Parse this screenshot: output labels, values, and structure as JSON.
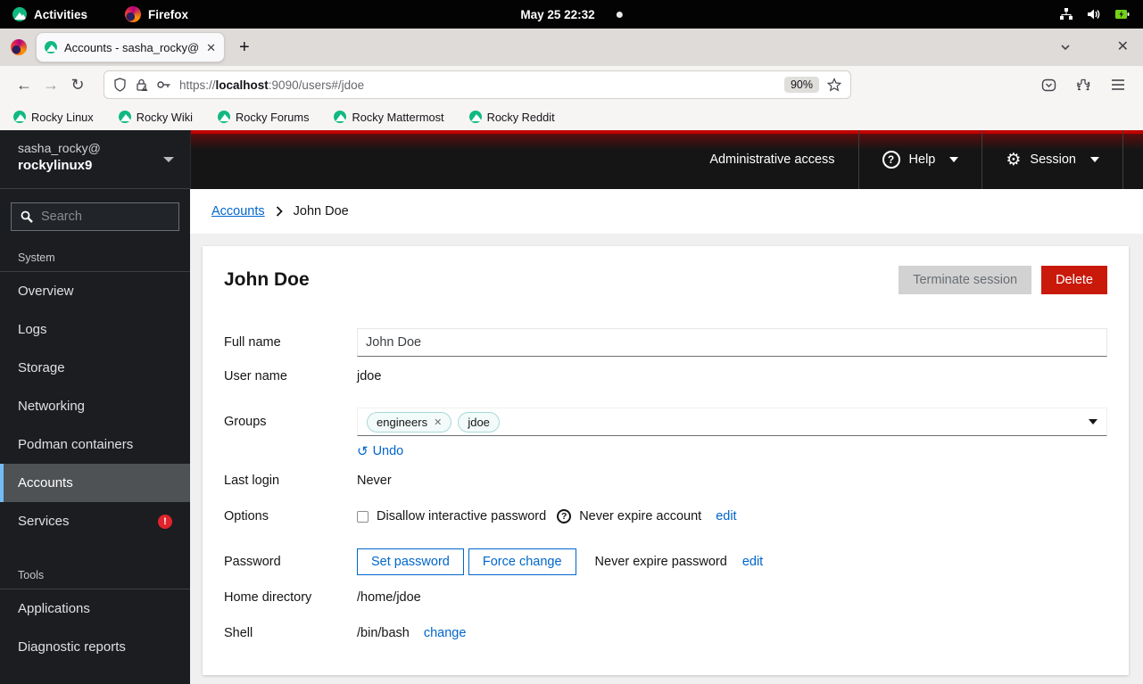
{
  "gnome_bar": {
    "activities_label": "Activities",
    "app_label": "Firefox",
    "clock": "May 25  22:32"
  },
  "browser": {
    "tab_title": "Accounts - sasha_rocky@",
    "url_prefix": "https://",
    "url_domain": "localhost",
    "url_path": ":9090/users#/jdoe",
    "zoom_level": "90%",
    "bookmarks": [
      {
        "label": "Rocky Linux"
      },
      {
        "label": "Rocky Wiki"
      },
      {
        "label": "Rocky Forums"
      },
      {
        "label": "Rocky Mattermost"
      },
      {
        "label": "Rocky Reddit"
      }
    ]
  },
  "sidebar": {
    "user": "sasha_rocky@",
    "host": "rockylinux9",
    "search_placeholder": "Search",
    "sections": [
      {
        "label": "System",
        "items": [
          {
            "label": "Overview"
          },
          {
            "label": "Logs"
          },
          {
            "label": "Storage"
          },
          {
            "label": "Networking"
          },
          {
            "label": "Podman containers"
          },
          {
            "label": "Accounts"
          },
          {
            "label": "Services",
            "badge": "!"
          }
        ]
      },
      {
        "label": "Tools",
        "items": [
          {
            "label": "Applications"
          },
          {
            "label": "Diagnostic reports"
          }
        ]
      }
    ]
  },
  "masthead": {
    "admin_access": "Administrative access",
    "help_label": "Help",
    "help_icon_glyph": "?",
    "session_label": "Session",
    "gear_glyph": "⚙"
  },
  "breadcrumb": {
    "parent": "Accounts",
    "current": "John Doe"
  },
  "account": {
    "title": "John Doe",
    "terminate_button": "Terminate session",
    "delete_button": "Delete",
    "full_name_label": "Full name",
    "full_name_value": "John Doe",
    "user_name_label": "User name",
    "user_name_value": "jdoe",
    "groups_label": "Groups",
    "chips": [
      {
        "label": "engineers",
        "remove_glyph": "✕"
      },
      {
        "label": "jdoe"
      }
    ],
    "undo_label": "Undo",
    "undo_glyph": "↺",
    "last_login_label": "Last login",
    "last_login_value": "Never",
    "options_label": "Options",
    "disallow_label": "Disallow interactive password",
    "never_expire_account": "Never expire account",
    "edit_account_expiry": "edit",
    "password_label": "Password",
    "set_password_button": "Set password",
    "force_change_button": "Force change",
    "never_expire_password": "Never expire password",
    "edit_password_expiry": "edit",
    "home_dir_label": "Home directory",
    "home_dir_value": "/home/jdoe",
    "shell_label": "Shell",
    "shell_value": "/bin/bash",
    "change_shell": "change"
  },
  "colors": {
    "accent_link": "#0066cc",
    "danger": "#c9190b",
    "masthead_stripe": "#c00000",
    "rocky_green": "#10b981",
    "nav_active_bar": "#73bcf7",
    "services_badge": "#e0242b"
  }
}
